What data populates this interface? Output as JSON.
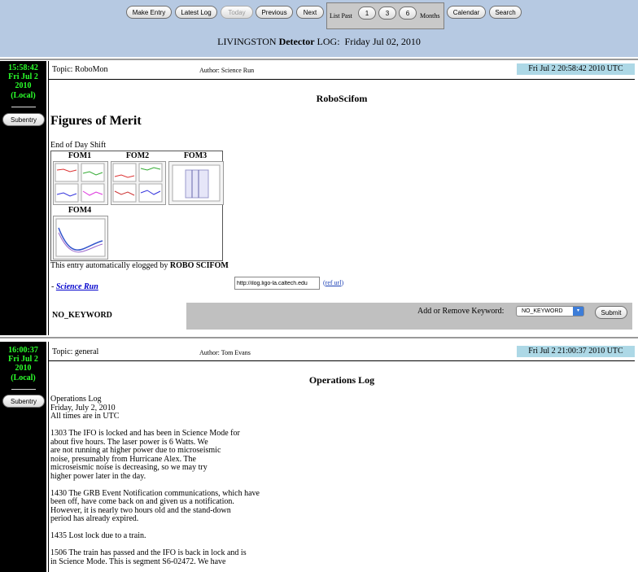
{
  "nav": {
    "make_entry": "Make Entry",
    "latest_log": "Latest Log",
    "today": "Today",
    "previous": "Previous",
    "next": "Next",
    "list_past": "List Past",
    "n1": "1",
    "n3": "3",
    "n6": "6",
    "months": "Months",
    "calendar": "Calendar",
    "search": "Search"
  },
  "header": {
    "prefix": "LIVINGSTON",
    "bold": "Detector",
    "suffix": "LOG:",
    "date": "Friday Jul 02, 2010"
  },
  "entry1": {
    "time": "15:58:42",
    "day": "Fri Jul 2",
    "year": "2010",
    "local": "(Local)",
    "subentry": "Subentry",
    "topic": "Topic: RoboMon",
    "author": "Author: Science Run",
    "utc_date": "Fri Jul  2 20:58:42 2010 UTC",
    "title": "RoboScifom",
    "heading": "Figures of Merit",
    "shift": "End of Day Shift",
    "fom_labels": [
      "FOM1",
      "FOM2",
      "FOM3",
      "FOM4"
    ],
    "auto_prefix": "This entry automatically elogged by",
    "auto_bold": "ROBO SCIFOM",
    "link_prefix": "-",
    "link": "Science Run",
    "url_value": "http://ilog.ligo-la.caltech.edu",
    "ref_url": "ref url",
    "keyword_label": "NO_KEYWORD",
    "add_remove_label": "Add or Remove Keyword:",
    "keyword_select": "NO_KEYWORD",
    "submit": "Submit"
  },
  "entry2": {
    "time": "16:00:37",
    "day": "Fri Jul 2",
    "year": "2010",
    "local": "(Local)",
    "subentry": "Subentry",
    "topic": "Topic: general",
    "author": "Author: Tom Evans",
    "utc_date": "Fri Jul  2 21:00:37 2010 UTC",
    "title": "Operations Log",
    "lines": [
      "Operations Log",
      "Friday, July 2, 2010",
      "All times are in UTC",
      "",
      "1303 The IFO is locked and has been in Science Mode for",
      "about five hours. The laser power is 6 Watts. We",
      "are not running at higher power due to microseismic",
      "noise, presumably from Hurricane Alex. The",
      "microseismic noise is decreasing, so we may try",
      "higher power later in the day.",
      "",
      "1430 The GRB Event Notification communications, which have",
      "been off, have come back on and given us a notification.",
      "However, it is nearly two hours old and the stand-down",
      "period has already expired.",
      "",
      "1435 Lost lock due to a train.",
      "",
      "1506 The train has passed and the IFO is back in lock and is",
      "in Science Mode. This is segment S6-02472. We have"
    ]
  }
}
